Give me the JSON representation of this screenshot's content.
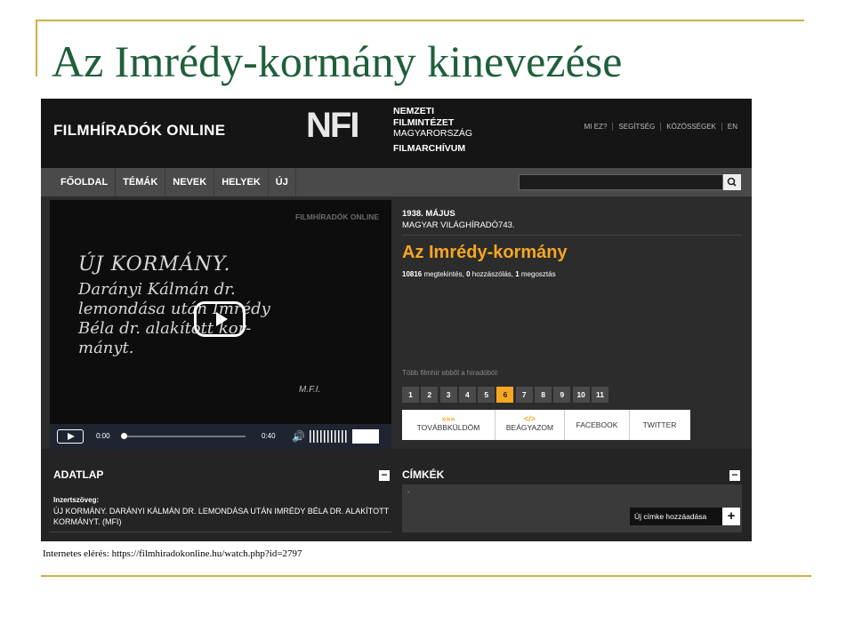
{
  "slide": {
    "title": "Az Imrédy-kormány kinevezése",
    "caption": "Internetes elérés: https://filmhiradokonline.hu/watch.php?id=2797"
  },
  "header": {
    "brand": "FILMHÍRADÓK ONLINE",
    "logo": "NFI",
    "org_line1": "NEMZETI",
    "org_line2": "FILMINTÉZET",
    "org_line3": "MAGYARORSZÁG",
    "org_line4": "FILMARCHÍVUM",
    "links": [
      "MI EZ?",
      "SEGÍTSÉG",
      "KÖZÖSSÉGEK",
      "EN"
    ]
  },
  "nav": {
    "items": [
      "FŐOLDAL",
      "TÉMÁK",
      "NEVEK",
      "HELYEK",
      "ÚJ"
    ],
    "search_placeholder": ""
  },
  "video": {
    "watermark": "FILMHÍRADÓK ONLINE",
    "frame_heading": "ÚJ KORMÁNY.",
    "frame_line1": "Darányi Kálmán dr.",
    "frame_line2": "lemondása után Imrédy",
    "frame_line3": "Béla dr. alakított kor-",
    "frame_line4": "mányt.",
    "frame_sign": "M.F.I.",
    "time_current": "0:00",
    "time_total": "0:40",
    "progress": 0
  },
  "info": {
    "date": "1938. MÁJUS",
    "series": "MAGYAR VILÁGHÍRADÓ743.",
    "title": "Az Imrédy-kormány",
    "views": "10816",
    "views_label": " megtekintés, ",
    "comments": "0",
    "comments_label": " hozzászólás, ",
    "shares": "1",
    "shares_label": " megosztás",
    "more_label": "Több filmhír ebből a híradóból:",
    "pages": [
      "1",
      "2",
      "3",
      "4",
      "5",
      "6",
      "7",
      "8",
      "9",
      "10",
      "11"
    ],
    "active_page": "6",
    "share": {
      "forward_icon": "»»»",
      "forward": "TOVÁBBKÜLDÖM",
      "embed_icon": "</>",
      "embed": "BEÁGYAZOM",
      "facebook": "FACEBOOK",
      "twitter": "TWITTER"
    }
  },
  "adatlap": {
    "title": "ADATLAP",
    "toggle": "−",
    "label": "Inzertszöveg:",
    "text": "ÚJ KORMÁNY. DARÁNYI KÁLMÁN DR. LEMONDÁSA UTÁN IMRÉDY BÉLA DR. ALAKÍTOTT KORMÁNYT. (MFI)"
  },
  "tags": {
    "title": "CÍMKÉK",
    "toggle": "−",
    "empty": "-",
    "new_tag": "Új címke hozzáadása",
    "plus": "+"
  },
  "colors": {
    "title_green": "#1f5f3a",
    "accent_orange": "#f5a623",
    "gold_line": "#c9b14a"
  }
}
